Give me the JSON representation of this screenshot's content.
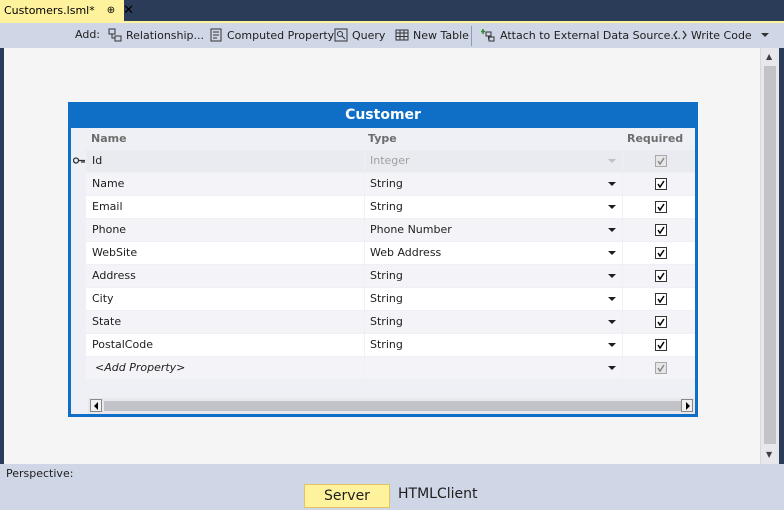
{
  "tab": {
    "title": "Customers.lsml*",
    "pin": "⊕",
    "close": "✕"
  },
  "toolbar": {
    "add_label": "Add:",
    "relationship": "Relationship...",
    "computed_property": "Computed Property",
    "query": "Query",
    "new_table": "New Table",
    "attach": "Attach to External Data Source...",
    "write_code": "Write Code"
  },
  "entity": {
    "title": "Customer",
    "headers": {
      "name": "Name",
      "type": "Type",
      "required": "Required"
    },
    "rows": [
      {
        "name": "Id",
        "type": "Integer",
        "required": true,
        "key": true
      },
      {
        "name": "Name",
        "type": "String",
        "required": true
      },
      {
        "name": "Email",
        "type": "String",
        "required": true
      },
      {
        "name": "Phone",
        "type": "Phone Number",
        "required": true
      },
      {
        "name": "WebSite",
        "type": "Web Address",
        "required": true
      },
      {
        "name": "Address",
        "type": "String",
        "required": true
      },
      {
        "name": "City",
        "type": "String",
        "required": true
      },
      {
        "name": "State",
        "type": "String",
        "required": true
      },
      {
        "name": "PostalCode",
        "type": "String",
        "required": true
      }
    ],
    "add_property": "<Add Property>"
  },
  "perspective": {
    "label": "Perspective:",
    "server": "Server",
    "htmlclient": "HTMLClient"
  },
  "colors": {
    "accent": "#0f6fc6",
    "tab_active": "#fff29d",
    "chrome": "#cfd6e5"
  }
}
